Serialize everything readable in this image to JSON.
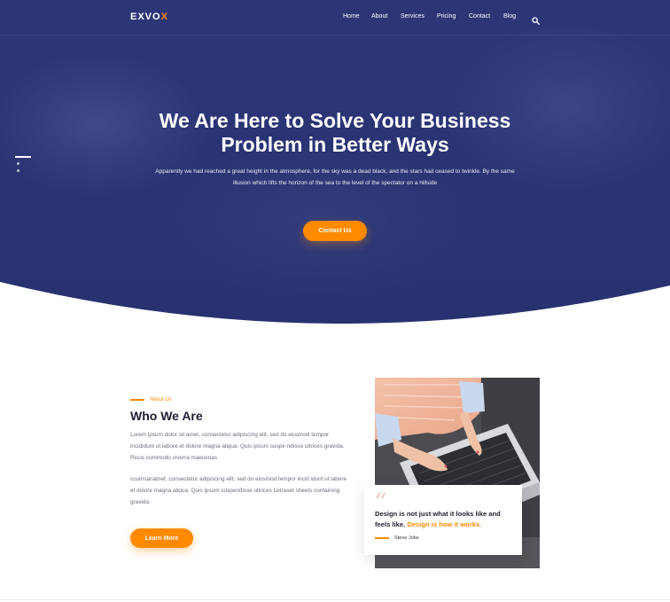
{
  "brand": {
    "logo_main": "EXVO",
    "logo_accent": "X"
  },
  "nav": {
    "items": [
      "Home",
      "About",
      "Services",
      "Pricing",
      "Contact",
      "Blog"
    ],
    "search_icon": "search-icon"
  },
  "hero": {
    "title_line1": "We Are Here to Solve Your Business",
    "title_line2": "Problem in Better Ways",
    "text": "Apparently we had reached a great height in the atmosphere, for the sky was a dead black, and the stars had ceased to twinkle. By the same illusion which lifts the horizon of the sea to the level of the spectator on a hillside",
    "cta": "Contact Us"
  },
  "about": {
    "eyebrow": "About Us",
    "title": "Who We Are",
    "paragraph1": "Lorem ipsum dolor sit amet, consectetur adipiscing elit, sed do eiusmod tempor incididunt ut labore et dolore magna aliqua. Quis ipsum suspe ndisse ultrices gravida. Risus commodo viverra maecenas",
    "paragraph2": "ccumsanamet, consectetur adipiscing elit, sed do eiusmod tempor incid idunt ut labore et dolore magna aliqua. Quis ipsum suspendisse ultrices Letraset sheets containing gravida.",
    "button": "Learn More"
  },
  "quote": {
    "mark": "“",
    "text_plain": "Design is not just what it looks like and feels like.",
    "text_highlight": "Design is how it works.",
    "author": "Steve Jobs"
  },
  "colors": {
    "primary": "#2c3677",
    "accent": "#ff8a00",
    "heading": "#1d1d35"
  }
}
